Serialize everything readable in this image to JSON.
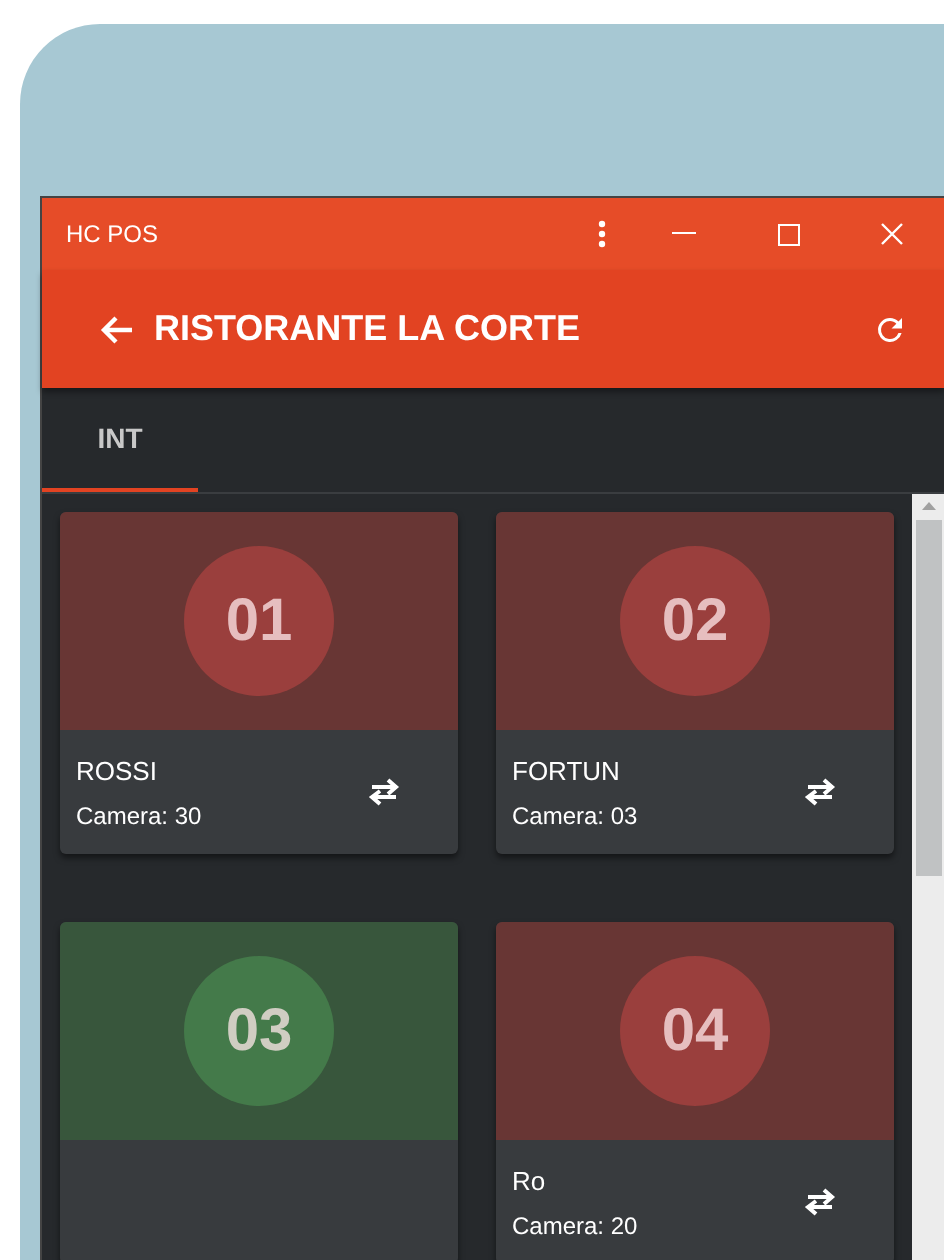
{
  "window": {
    "title": "HC POS"
  },
  "app_bar": {
    "title": "RISTORANTE LA CORTE"
  },
  "tabs": [
    {
      "label": "INT",
      "selected": true
    }
  ],
  "tables": [
    {
      "number": "01",
      "color": "#9a3f3d",
      "name": "ROSSI",
      "room": "Camera: 30"
    },
    {
      "number": "02",
      "color": "#9a3f3d",
      "name": "FORTUN",
      "room": "Camera: 03"
    },
    {
      "number": "03",
      "color": "#447a4a"
    },
    {
      "number": "04",
      "color": "#9a3f3d",
      "name": "Ro",
      "room": "Camera: 20"
    }
  ]
}
